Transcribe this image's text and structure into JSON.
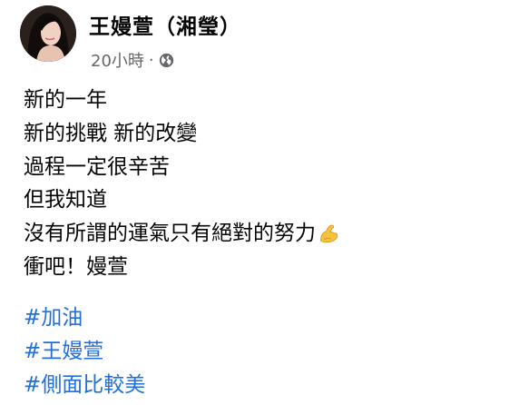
{
  "post": {
    "author_name": "王嫚萱（湘瑩）",
    "timestamp": "20小時",
    "separator": "·",
    "audience_icon": "globe-icon",
    "lines": [
      "新的一年",
      "新的挑戰 新的改變",
      "過程一定很辛苦",
      "但我知道",
      "沒有所謂的運氣只有絕對的努力",
      "衝吧！嫚萱"
    ],
    "emoji_after_line_5": "flexed-biceps-emoji",
    "hashtags": [
      "#加油",
      "#王嫚萱",
      "#側面比較美"
    ]
  },
  "colors": {
    "text": "#050505",
    "secondary_text": "#65676b",
    "hashtag": "#216fdb",
    "background": "#ffffff"
  }
}
